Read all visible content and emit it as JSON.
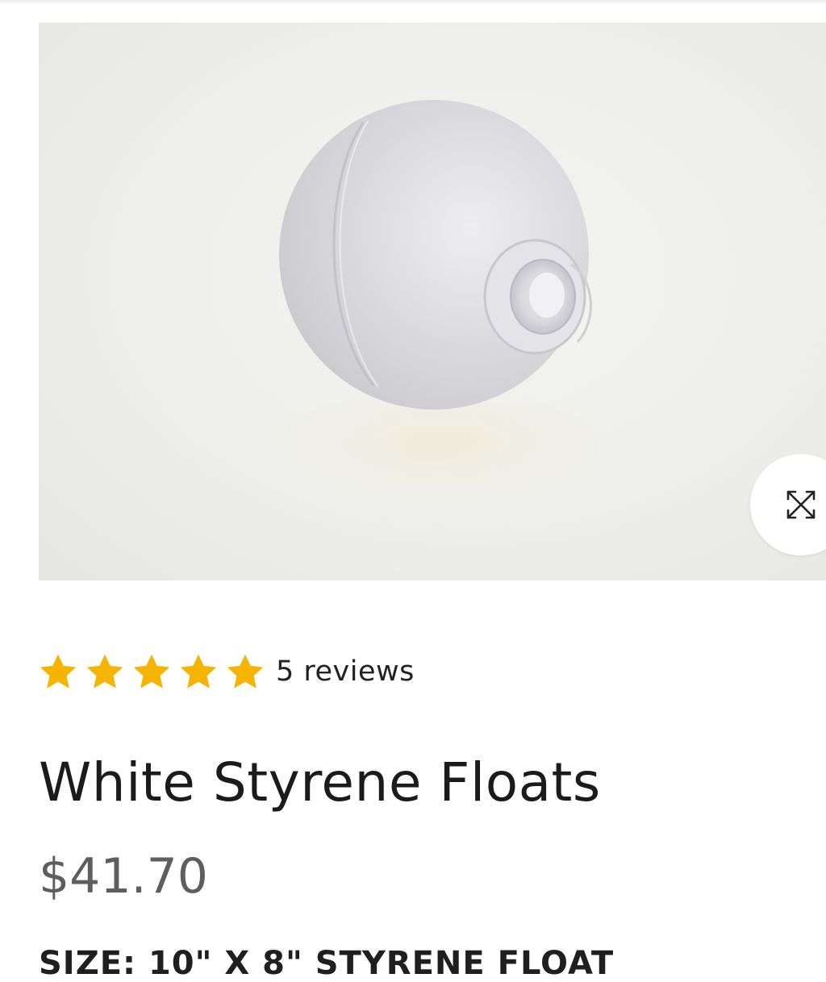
{
  "product": {
    "image_alt": "White styrene float",
    "zoom_icon": "expand-arrows-icon",
    "rating": {
      "stars": 5,
      "max_stars": 5,
      "star_color": "#f5b400",
      "reviews_label": "5 reviews"
    },
    "title": "White Styrene Floats",
    "price": "$41.70",
    "option_label": "SIZE: 10\" X 8\" STYRENE FLOAT"
  }
}
